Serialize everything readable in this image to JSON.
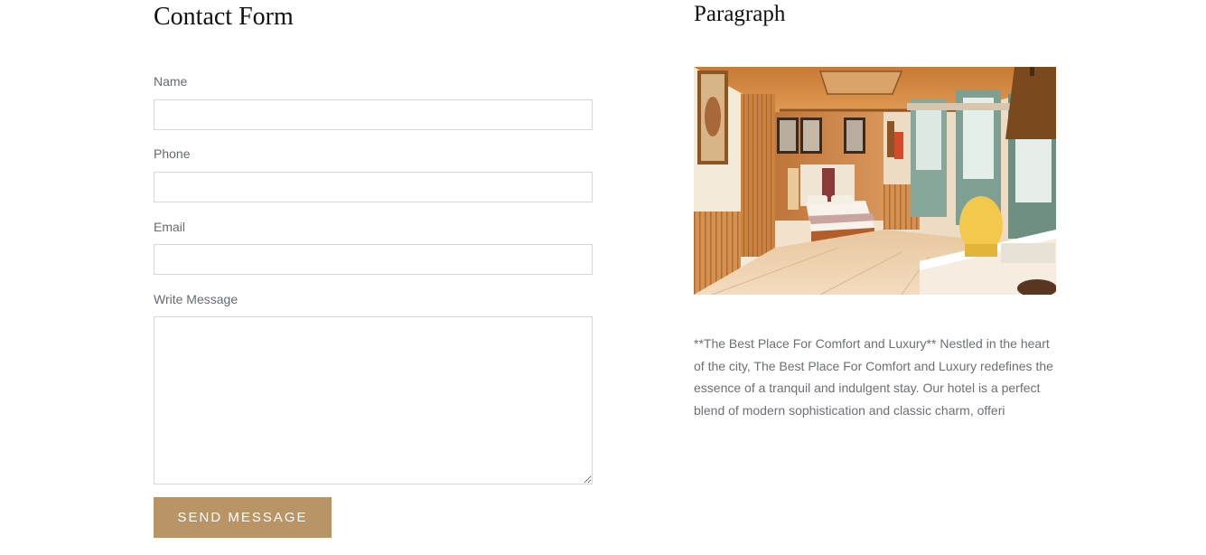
{
  "contact_form": {
    "title": "Contact Form",
    "fields": {
      "name": {
        "label": "Name",
        "value": ""
      },
      "phone": {
        "label": "Phone",
        "value": ""
      },
      "email": {
        "label": "Email",
        "value": ""
      },
      "message": {
        "label": "Write Message",
        "value": ""
      }
    },
    "submit_label": "SEND MESSAGE"
  },
  "paragraph_section": {
    "title": "Paragraph",
    "image": {
      "name": "hotel-room-photo"
    },
    "body": "**The Best Place For Comfort and Luxury** Nestled in the heart of the city, The Best Place For Comfort and Luxury redefines the essence of a tranquil and indulgent stay. Our hotel is a perfect blend of modern sophistication and classic charm, offeri"
  },
  "colors": {
    "accent": "#b89467",
    "heading": "#111111",
    "label": "#666a70",
    "body_text": "#6b6f76",
    "input_border": "#d6d6d6"
  }
}
